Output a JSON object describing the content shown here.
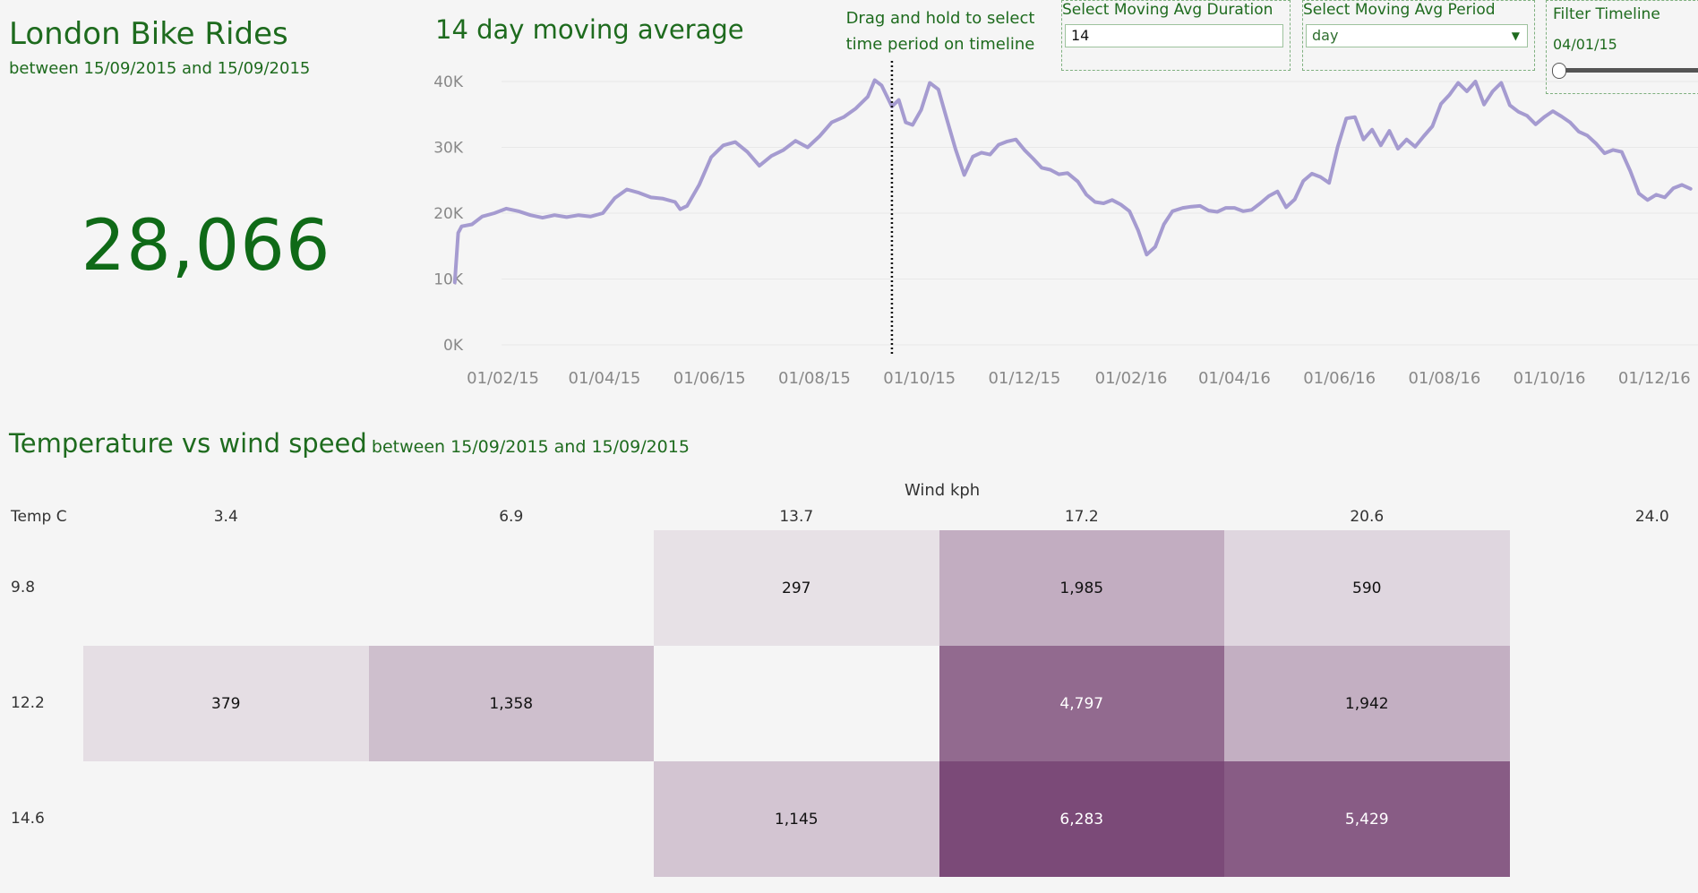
{
  "header": {
    "title": "London Bike Rides",
    "subtitle": "between 15/09/2015 and 15/09/2015",
    "kpi_value": "28,066"
  },
  "line_chart": {
    "title": "14 day moving average",
    "drag_note_line1": "Drag and hold to select",
    "drag_note_line2": "time period on timeline",
    "line_color": "#a59bd0"
  },
  "controls": {
    "duration": {
      "label": "Select Moving Avg Duration",
      "value": "14"
    },
    "period": {
      "label": "Select Moving Avg Period",
      "value": "day"
    },
    "timeline": {
      "label": "Filter Timeline",
      "value": "04/01/15"
    }
  },
  "heatmap": {
    "title": "Temperature vs wind speed",
    "subtitle": "between 15/09/2015 and 15/09/2015",
    "col_axis_label": "Wind kph",
    "row_axis_label": "Temp C",
    "columns": [
      "3.4",
      "6.9",
      "13.7",
      "17.2",
      "20.6",
      "24.0"
    ],
    "rows": [
      "9.8",
      "12.2",
      "14.6"
    ]
  },
  "chart_data": [
    {
      "type": "line",
      "title": "14 day moving average",
      "x_tick_labels": [
        "01/02/15",
        "01/04/15",
        "01/06/15",
        "01/08/15",
        "01/10/15",
        "01/12/15",
        "01/02/16",
        "01/04/16",
        "01/06/16",
        "01/08/16",
        "01/10/16",
        "01/12/16"
      ],
      "y_tick_labels": [
        "0K",
        "10K",
        "20K",
        "30K",
        "40K"
      ],
      "ylim": [
        0,
        40000
      ],
      "xlim": [
        "2015-01-01",
        "2016-12-31"
      ],
      "grid": true,
      "marker_date": "2015-09-15",
      "series": [
        {
          "points": [
            [
              "2015-01-04",
              9500
            ],
            [
              "2015-01-06",
              17000
            ],
            [
              "2015-01-08",
              18000
            ],
            [
              "2015-01-14",
              18300
            ],
            [
              "2015-01-20",
              19500
            ],
            [
              "2015-01-27",
              20000
            ],
            [
              "2015-02-03",
              20700
            ],
            [
              "2015-02-10",
              20300
            ],
            [
              "2015-02-17",
              19700
            ],
            [
              "2015-02-24",
              19300
            ],
            [
              "2015-03-03",
              19700
            ],
            [
              "2015-03-10",
              19400
            ],
            [
              "2015-03-17",
              19700
            ],
            [
              "2015-03-24",
              19500
            ],
            [
              "2015-03-31",
              20000
            ],
            [
              "2015-04-07",
              22300
            ],
            [
              "2015-04-14",
              23600
            ],
            [
              "2015-04-21",
              23100
            ],
            [
              "2015-04-28",
              22400
            ],
            [
              "2015-05-05",
              22200
            ],
            [
              "2015-05-12",
              21700
            ],
            [
              "2015-05-15",
              20600
            ],
            [
              "2015-05-19",
              21100
            ],
            [
              "2015-05-26",
              24300
            ],
            [
              "2015-06-02",
              28500
            ],
            [
              "2015-06-09",
              30300
            ],
            [
              "2015-06-16",
              30800
            ],
            [
              "2015-06-23",
              29300
            ],
            [
              "2015-06-30",
              27200
            ],
            [
              "2015-07-07",
              28700
            ],
            [
              "2015-07-14",
              29600
            ],
            [
              "2015-07-21",
              31000
            ],
            [
              "2015-07-28",
              30000
            ],
            [
              "2015-08-04",
              31700
            ],
            [
              "2015-08-11",
              33800
            ],
            [
              "2015-08-18",
              34600
            ],
            [
              "2015-08-25",
              35900
            ],
            [
              "2015-09-01",
              37700
            ],
            [
              "2015-09-05",
              40200
            ],
            [
              "2015-09-09",
              39400
            ],
            [
              "2015-09-15",
              36200
            ],
            [
              "2015-09-19",
              37200
            ],
            [
              "2015-09-23",
              33800
            ],
            [
              "2015-09-27",
              33400
            ],
            [
              "2015-10-02",
              35700
            ],
            [
              "2015-10-07",
              39800
            ],
            [
              "2015-10-12",
              38800
            ],
            [
              "2015-10-17",
              34200
            ],
            [
              "2015-10-22",
              29700
            ],
            [
              "2015-10-27",
              25800
            ],
            [
              "2015-11-01",
              28600
            ],
            [
              "2015-11-06",
              29200
            ],
            [
              "2015-11-11",
              28900
            ],
            [
              "2015-11-16",
              30400
            ],
            [
              "2015-11-21",
              30900
            ],
            [
              "2015-11-26",
              31200
            ],
            [
              "2015-12-01",
              29600
            ],
            [
              "2015-12-06",
              28300
            ],
            [
              "2015-12-11",
              26900
            ],
            [
              "2015-12-16",
              26600
            ],
            [
              "2015-12-21",
              25900
            ],
            [
              "2015-12-26",
              26100
            ],
            [
              "2016-01-01",
              24800
            ],
            [
              "2016-01-06",
              22800
            ],
            [
              "2016-01-11",
              21700
            ],
            [
              "2016-01-16",
              21500
            ],
            [
              "2016-01-21",
              22000
            ],
            [
              "2016-01-26",
              21300
            ],
            [
              "2016-01-31",
              20300
            ],
            [
              "2016-02-05",
              17400
            ],
            [
              "2016-02-10",
              13700
            ],
            [
              "2016-02-15",
              14900
            ],
            [
              "2016-02-20",
              18300
            ],
            [
              "2016-02-25",
              20300
            ],
            [
              "2016-03-02",
              20800
            ],
            [
              "2016-03-07",
              21000
            ],
            [
              "2016-03-12",
              21100
            ],
            [
              "2016-03-17",
              20400
            ],
            [
              "2016-03-22",
              20200
            ],
            [
              "2016-03-27",
              20800
            ],
            [
              "2016-04-01",
              20800
            ],
            [
              "2016-04-06",
              20300
            ],
            [
              "2016-04-11",
              20500
            ],
            [
              "2016-04-16",
              21500
            ],
            [
              "2016-04-21",
              22600
            ],
            [
              "2016-04-26",
              23300
            ],
            [
              "2016-05-01",
              20900
            ],
            [
              "2016-05-06",
              22100
            ],
            [
              "2016-05-11",
              24900
            ],
            [
              "2016-05-16",
              26000
            ],
            [
              "2016-05-21",
              25500
            ],
            [
              "2016-05-26",
              24600
            ],
            [
              "2016-05-31",
              30100
            ],
            [
              "2016-06-05",
              34400
            ],
            [
              "2016-06-10",
              34600
            ],
            [
              "2016-06-15",
              31200
            ],
            [
              "2016-06-20",
              32700
            ],
            [
              "2016-06-25",
              30300
            ],
            [
              "2016-06-30",
              32500
            ],
            [
              "2016-07-05",
              29800
            ],
            [
              "2016-07-10",
              31200
            ],
            [
              "2016-07-15",
              30100
            ],
            [
              "2016-07-20",
              31700
            ],
            [
              "2016-07-25",
              33200
            ],
            [
              "2016-07-30",
              36600
            ],
            [
              "2016-08-04",
              38000
            ],
            [
              "2016-08-09",
              39800
            ],
            [
              "2016-08-14",
              38500
            ],
            [
              "2016-08-19",
              40000
            ],
            [
              "2016-08-24",
              36500
            ],
            [
              "2016-08-29",
              38500
            ],
            [
              "2016-09-03",
              39800
            ],
            [
              "2016-09-08",
              36400
            ],
            [
              "2016-09-13",
              35400
            ],
            [
              "2016-09-18",
              34800
            ],
            [
              "2016-09-23",
              33500
            ],
            [
              "2016-09-28",
              34600
            ],
            [
              "2016-10-03",
              35500
            ],
            [
              "2016-10-08",
              34700
            ],
            [
              "2016-10-13",
              33800
            ],
            [
              "2016-10-18",
              32400
            ],
            [
              "2016-10-23",
              31800
            ],
            [
              "2016-10-28",
              30600
            ],
            [
              "2016-11-02",
              29100
            ],
            [
              "2016-11-07",
              29600
            ],
            [
              "2016-11-12",
              29300
            ],
            [
              "2016-11-17",
              26400
            ],
            [
              "2016-11-22",
              23000
            ],
            [
              "2016-11-27",
              22000
            ],
            [
              "2016-12-02",
              22800
            ],
            [
              "2016-12-07",
              22400
            ],
            [
              "2016-12-12",
              23800
            ],
            [
              "2016-12-17",
              24300
            ],
            [
              "2016-12-22",
              23700
            ]
          ]
        }
      ]
    },
    {
      "type": "heatmap",
      "title": "Temperature vs wind speed",
      "xlabel": "Wind kph",
      "ylabel": "Temp C",
      "x": [
        "3.4",
        "6.9",
        "13.7",
        "17.2",
        "20.6",
        "24.0"
      ],
      "y": [
        "9.8",
        "12.2",
        "14.6"
      ],
      "cells": [
        {
          "row": "9.8",
          "col": "13.7",
          "value": 297
        },
        {
          "row": "9.8",
          "col": "17.2",
          "value": 1985
        },
        {
          "row": "9.8",
          "col": "20.6",
          "value": 590
        },
        {
          "row": "12.2",
          "col": "3.4",
          "value": 379
        },
        {
          "row": "12.2",
          "col": "6.9",
          "value": 1358
        },
        {
          "row": "12.2",
          "col": "17.2",
          "value": 4797
        },
        {
          "row": "12.2",
          "col": "20.6",
          "value": 1942
        },
        {
          "row": "14.6",
          "col": "13.7",
          "value": 1145
        },
        {
          "row": "14.6",
          "col": "17.2",
          "value": 6283
        },
        {
          "row": "14.6",
          "col": "20.6",
          "value": 5429
        }
      ],
      "color_low": "#f1eff1",
      "color_high": "#7b4a78"
    }
  ]
}
